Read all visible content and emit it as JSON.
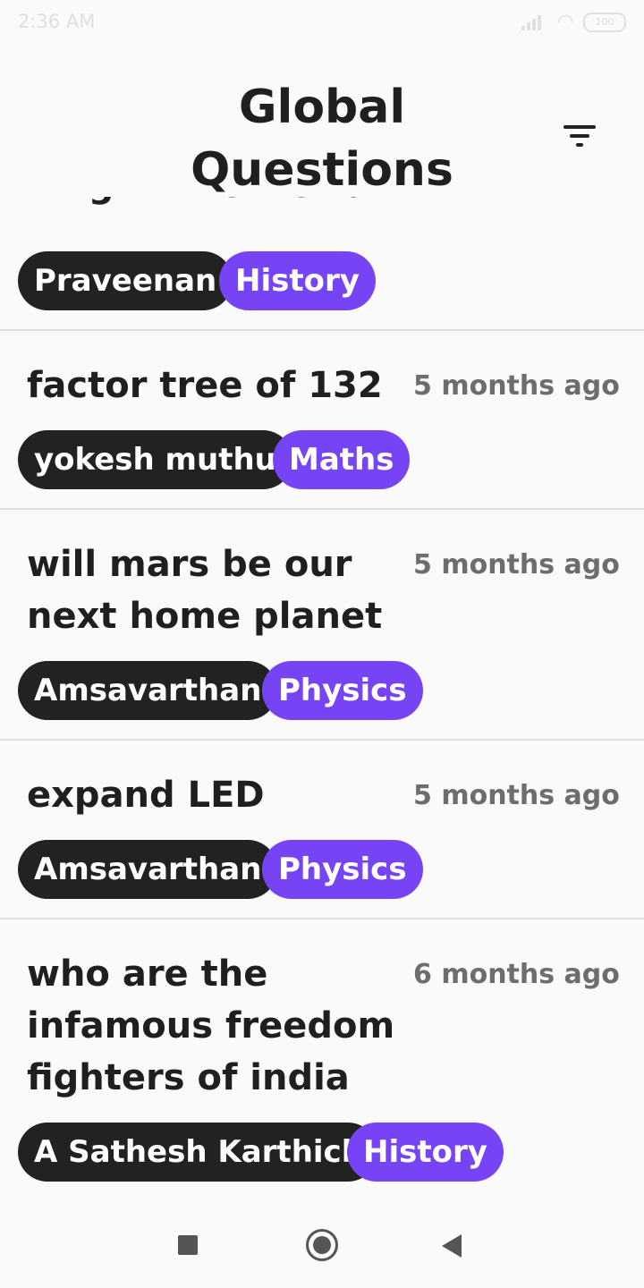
{
  "status_bar": {
    "time": "2:36 AM",
    "battery": "100",
    "icons": [
      "signal-icon",
      "wifi-icon",
      "battery-icon"
    ]
  },
  "header": {
    "title": "Global Questions",
    "filter_icon": "filter-icon"
  },
  "partial_item": {
    "clipped_title": "king in the world",
    "author": "Praveenan",
    "subject": "History"
  },
  "questions": [
    {
      "title": "factor tree of 132",
      "time": "5 months ago",
      "author": "yokesh muthu",
      "subject": "Maths"
    },
    {
      "title": "will mars be our next home planet",
      "time": "5 months ago",
      "author": "Amsavarthan",
      "subject": "Physics"
    },
    {
      "title": "expand LED",
      "time": "5 months ago",
      "author": "Amsavarthan",
      "subject": "Physics"
    },
    {
      "title": "who are the infamous freedom fighters of india",
      "time": "6 months ago",
      "author": "A Sathesh Karthick",
      "subject": "History"
    }
  ],
  "nav_bar": {
    "icons": [
      "recents-square-icon",
      "home-circle-icon",
      "back-triangle-icon"
    ]
  },
  "colors": {
    "author_chip": "#222222",
    "subject_chip": "#7744f5",
    "timestamp": "#6d6d6d",
    "background": "#fafafa"
  }
}
